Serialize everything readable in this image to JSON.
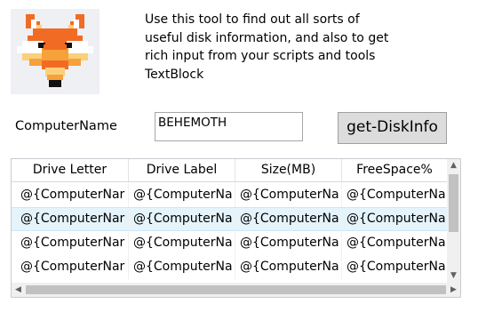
{
  "description_lines": [
    "Use this tool to find out all sorts of",
    "useful disk information, and also to get",
    "rich input from your scripts and tools",
    "TextBlock"
  ],
  "form": {
    "computer_label": "ComputerName",
    "computer_value": "BEHEMOTH",
    "button_label": "get-DiskInfo"
  },
  "grid": {
    "columns": [
      "Drive Letter",
      "Drive Label",
      "Size(MB)",
      "FreeSpace%"
    ],
    "rows": [
      [
        "@{ComputerNar",
        "@{ComputerNa",
        "@{ComputerNa",
        "@{ComputerNa"
      ],
      [
        "@{ComputerNar",
        "@{ComputerNa",
        "@{ComputerNa",
        "@{ComputerNa"
      ],
      [
        "@{ComputerNar",
        "@{ComputerNa",
        "@{ComputerNa",
        "@{ComputerNa"
      ],
      [
        "@{ComputerNar",
        "@{ComputerNa",
        "@{ComputerNa",
        "@{ComputerNa"
      ]
    ],
    "selected_row": 1
  },
  "icons": {
    "logo": "fox-logo-icon",
    "scroll_up": "chevron-up-icon",
    "scroll_down": "chevron-down-icon",
    "scroll_left": "chevron-left-icon",
    "scroll_right": "chevron-right-icon"
  },
  "colors": {
    "fox_orange": "#f26b24",
    "fox_light_orange": "#f7a13a",
    "fox_yellow": "#fbd07a",
    "selected_row": "#e5f3fb",
    "button_bg": "#dcdcdc"
  }
}
